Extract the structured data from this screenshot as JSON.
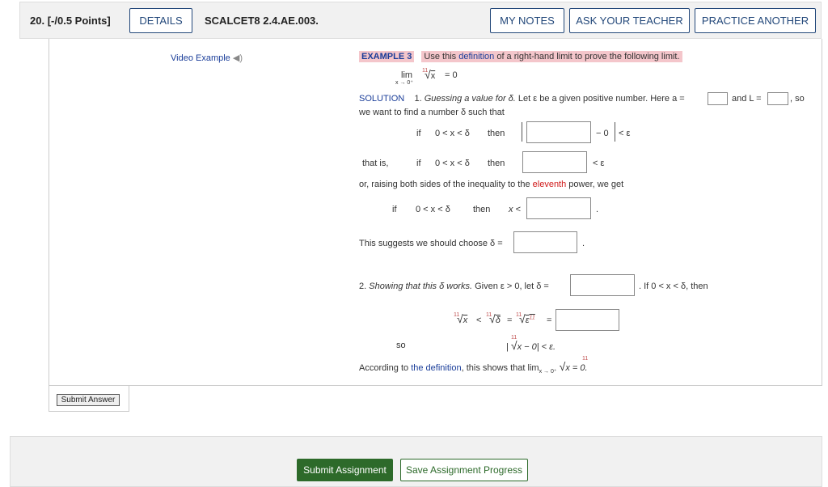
{
  "header": {
    "question_number": "20.",
    "points": "[-/0.5 Points]",
    "details_label": "DETAILS",
    "question_id": "SCALCET8 2.4.AE.003.",
    "my_notes_label": "MY NOTES",
    "ask_teacher_label": "ASK YOUR TEACHER",
    "practice_another_label": "PRACTICE ANOTHER"
  },
  "video_example": "Video Example",
  "example": {
    "tag": "EXAMPLE 3",
    "prompt_pre": "Use this ",
    "prompt_link": "definition",
    "prompt_post": " of a right-hand limit to prove the following limit.",
    "lim_word": "lim",
    "lim_sub": "x → 0⁺",
    "root_index": "11",
    "root_arg": "x",
    "eq_zero": "= 0"
  },
  "solution": {
    "label": "SOLUTION",
    "step1_num": "1.",
    "step1_italic": "Guessing a value for δ.",
    "step1_text": "Let ε be a given positive number. Here a =",
    "and_L": "and L =",
    "so": ", so",
    "line2": "we want to find a number δ such that",
    "if": "if",
    "cond": "0 < x < δ",
    "then": "then",
    "minus_zero": "− 0",
    "lt_eps": "< ε",
    "that_is": "that is,",
    "raise_pre": "or, raising both sides of the inequality to the ",
    "raise_red": "eleventh",
    "raise_post": " power, we get",
    "x_lt": "x <",
    "period": ".",
    "suggests": "This suggests we should choose δ =",
    "step2_num": "2.",
    "step2_italic": "Showing that this δ works.",
    "step2_text": "Given ε > 0, let δ =",
    "step2_tail": ". If 0 < x < δ,  then",
    "chain_lt": "<",
    "chain_eq1": "=",
    "chain_eq2": "=",
    "chain_x": "x",
    "chain_delta": "δ",
    "chain_eps": "ε",
    "chain_eps_exp": "11",
    "so_word": "so",
    "abs_line": "| ",
    "abs_rest": "x − 0| < ε.",
    "accord_pre": "According to ",
    "accord_link": "the definition",
    "accord_post": ", this shows that  lim",
    "accord_sub": "x → 0⁺",
    "accord_end": "x = 0."
  },
  "submit_answer_label": "Submit Answer",
  "footer": {
    "submit_assignment_label": "Submit Assignment",
    "save_progress_label": "Save Assignment Progress"
  }
}
